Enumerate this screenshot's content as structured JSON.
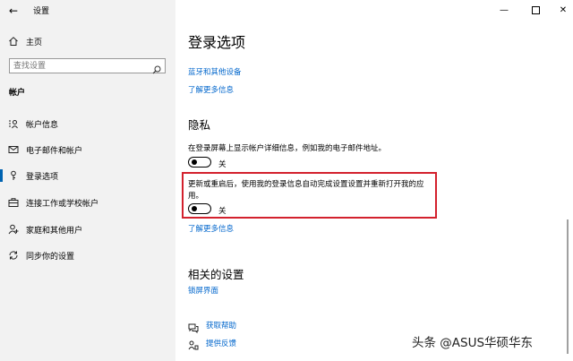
{
  "window": {
    "title": "设置",
    "controls": {
      "minimize": "—",
      "close": "✕"
    }
  },
  "sidebar": {
    "home": "主页",
    "search_placeholder": "查找设置",
    "section": "帐户",
    "items": [
      {
        "label": "帐户信息",
        "icon": "person-card-icon"
      },
      {
        "label": "电子邮件和帐户",
        "icon": "mail-icon"
      },
      {
        "label": "登录选项",
        "icon": "key-icon",
        "selected": true
      },
      {
        "label": "连接工作或学校帐户",
        "icon": "briefcase-icon"
      },
      {
        "label": "家庭和其他用户",
        "icon": "people-icon"
      },
      {
        "label": "同步你的设置",
        "icon": "sync-icon"
      }
    ]
  },
  "content": {
    "title": "登录选项",
    "link_bluetooth": "蓝牙和其他设备",
    "link_learn_more_1": "了解更多信息",
    "privacy": {
      "heading": "隐私",
      "show_account_details": {
        "label": "在登录屏幕上显示帐户详细信息，例如我的电子邮件地址。",
        "state": "关"
      },
      "use_signin_info": {
        "label_line1": "更新或重启后，使用我的登录信息自动完成设置设置并重新打开我的应",
        "label_line2": "用。",
        "state": "关"
      },
      "link_learn_more": "了解更多信息"
    },
    "related": {
      "heading": "相关的设置",
      "lock_screen": "锁屏界面"
    },
    "help": {
      "get_help": "获取帮助",
      "feedback": "提供反馈"
    }
  },
  "watermark": "头条 @ASUS华硕华东",
  "colors": {
    "accent": "#0063b1",
    "link": "#0066cc",
    "highlight_box": "#d3212d",
    "sidebar_bg": "#f2f2f2"
  }
}
